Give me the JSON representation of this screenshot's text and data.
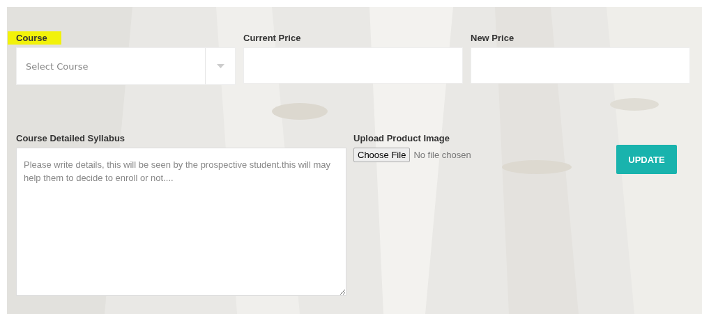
{
  "fields": [
    {
      "kind": "select",
      "label": "Course",
      "highlighted": true,
      "placeholder": "Select Course"
    },
    {
      "kind": "text",
      "label": "Current Price",
      "highlighted": false
    },
    {
      "kind": "text",
      "label": "New Price",
      "highlighted": false
    }
  ],
  "syllabus": {
    "label": "Course Detailed Syllabus",
    "placeholder": "Please write details, this will be seen by the prospective student.this will may help them to decide to enroll or not...."
  },
  "upload": {
    "label": "Upload Product Image",
    "button": "Choose File",
    "status": "No file chosen"
  },
  "submit": {
    "label": "UPDATE"
  }
}
